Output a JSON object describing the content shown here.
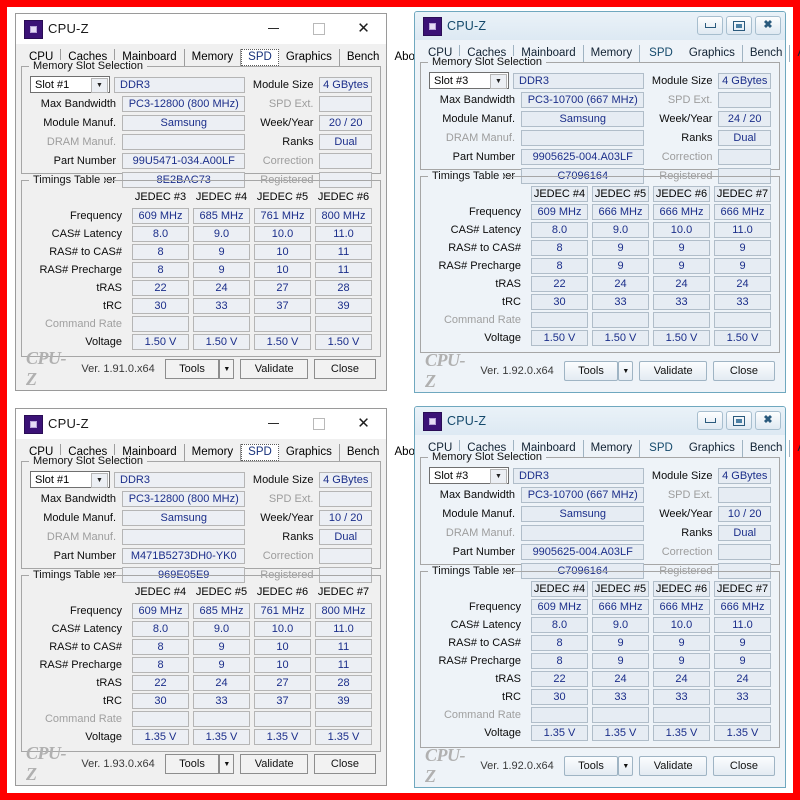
{
  "theme": {
    "outer_border_color": "#ff0000",
    "field_text_color": "#1b2e8a",
    "disabled_label_color": "#9d9d9d"
  },
  "common": {
    "window_title": "CPU-Z",
    "tabs": [
      "CPU",
      "Caches",
      "Mainboard",
      "Memory",
      "SPD",
      "Graphics",
      "Bench",
      "About"
    ],
    "selected_tab": "SPD",
    "group_slot_legend": "Memory Slot Selection",
    "group_timings_legend": "Timings Table",
    "labels": {
      "max_bandwidth": "Max Bandwidth",
      "module_manuf": "Module Manuf.",
      "dram_manuf": "DRAM Manuf.",
      "part_number": "Part Number",
      "serial_number": "Serial Number",
      "module_size": "Module Size",
      "spd_ext": "SPD Ext.",
      "week_year": "Week/Year",
      "ranks": "Ranks",
      "correction": "Correction",
      "registered": "Registered"
    },
    "timing_rows": [
      "Frequency",
      "CAS# Latency",
      "RAS# to CAS#",
      "RAS# Precharge",
      "tRAS",
      "tRC",
      "Command Rate",
      "Voltage"
    ],
    "buttons": {
      "tools": "Tools",
      "dropdown": "▼",
      "validate": "Validate",
      "close": "Close"
    },
    "brand": "CPU-Z",
    "icons": {
      "app": "cpu-chip-icon",
      "minimize": "minimize-icon",
      "maximize": "maximize-icon",
      "close": "close-icon",
      "dropdown": "chevron-down-icon"
    }
  },
  "panels": [
    {
      "id": "top-left",
      "style": "w10",
      "version": "Ver. 1.91.0.x64",
      "slot": {
        "selected_slot": "Slot #1",
        "memory_type": "DDR3",
        "max_bandwidth": "PC3-12800 (800 MHz)",
        "module_manuf": "Samsung",
        "dram_manuf": "",
        "part_number": "99U5471-034.A00LF",
        "serial_number": "8E2BAC73",
        "module_size": "4 GBytes",
        "spd_ext": "",
        "week_year": "20 / 20",
        "ranks": "Dual",
        "correction": "",
        "registered": ""
      },
      "timings": {
        "columns": [
          "JEDEC #3",
          "JEDEC #4",
          "JEDEC #5",
          "JEDEC #6"
        ],
        "rows": [
          {
            "label": "Frequency",
            "values": [
              "609 MHz",
              "685 MHz",
              "761 MHz",
              "800 MHz"
            ],
            "disabled": false
          },
          {
            "label": "CAS# Latency",
            "values": [
              "8.0",
              "9.0",
              "10.0",
              "11.0"
            ],
            "disabled": false
          },
          {
            "label": "RAS# to CAS#",
            "values": [
              "8",
              "9",
              "10",
              "11"
            ],
            "disabled": false
          },
          {
            "label": "RAS# Precharge",
            "values": [
              "8",
              "9",
              "10",
              "11"
            ],
            "disabled": false
          },
          {
            "label": "tRAS",
            "values": [
              "22",
              "24",
              "27",
              "28"
            ],
            "disabled": false
          },
          {
            "label": "tRC",
            "values": [
              "30",
              "33",
              "37",
              "39"
            ],
            "disabled": false
          },
          {
            "label": "Command Rate",
            "values": [
              "",
              "",
              "",
              ""
            ],
            "disabled": true
          },
          {
            "label": "Voltage",
            "values": [
              "1.50 V",
              "1.50 V",
              "1.50 V",
              "1.50 V"
            ],
            "disabled": false
          }
        ]
      }
    },
    {
      "id": "top-right",
      "style": "aero",
      "version": "Ver. 1.92.0.x64",
      "slot": {
        "selected_slot": "Slot #3",
        "memory_type": "DDR3",
        "max_bandwidth": "PC3-10700 (667 MHz)",
        "module_manuf": "Samsung",
        "dram_manuf": "",
        "part_number": "9905625-004.A03LF",
        "serial_number": "C7096164",
        "module_size": "4 GBytes",
        "spd_ext": "",
        "week_year": "24 / 20",
        "ranks": "Dual",
        "correction": "",
        "registered": ""
      },
      "timings": {
        "columns": [
          "JEDEC #4",
          "JEDEC #5",
          "JEDEC #6",
          "JEDEC #7"
        ],
        "rows": [
          {
            "label": "Frequency",
            "values": [
              "609 MHz",
              "666 MHz",
              "666 MHz",
              "666 MHz"
            ],
            "disabled": false
          },
          {
            "label": "CAS# Latency",
            "values": [
              "8.0",
              "9.0",
              "10.0",
              "11.0"
            ],
            "disabled": false
          },
          {
            "label": "RAS# to CAS#",
            "values": [
              "8",
              "9",
              "9",
              "9"
            ],
            "disabled": false
          },
          {
            "label": "RAS# Precharge",
            "values": [
              "8",
              "9",
              "9",
              "9"
            ],
            "disabled": false
          },
          {
            "label": "tRAS",
            "values": [
              "22",
              "24",
              "24",
              "24"
            ],
            "disabled": false
          },
          {
            "label": "tRC",
            "values": [
              "30",
              "33",
              "33",
              "33"
            ],
            "disabled": false
          },
          {
            "label": "Command Rate",
            "values": [
              "",
              "",
              "",
              ""
            ],
            "disabled": true
          },
          {
            "label": "Voltage",
            "values": [
              "1.50 V",
              "1.50 V",
              "1.50 V",
              "1.50 V"
            ],
            "disabled": false
          }
        ]
      }
    },
    {
      "id": "bottom-left",
      "style": "w10",
      "version": "Ver. 1.93.0.x64",
      "slot": {
        "selected_slot": "Slot #1",
        "memory_type": "DDR3",
        "max_bandwidth": "PC3-12800 (800 MHz)",
        "module_manuf": "Samsung",
        "dram_manuf": "",
        "part_number": "M471B5273DH0-YK0",
        "serial_number": "969E05E9",
        "module_size": "4 GBytes",
        "spd_ext": "",
        "week_year": "10 / 20",
        "ranks": "Dual",
        "correction": "",
        "registered": ""
      },
      "timings": {
        "columns": [
          "JEDEC #4",
          "JEDEC #5",
          "JEDEC #6",
          "JEDEC #7"
        ],
        "rows": [
          {
            "label": "Frequency",
            "values": [
              "609 MHz",
              "685 MHz",
              "761 MHz",
              "800 MHz"
            ],
            "disabled": false
          },
          {
            "label": "CAS# Latency",
            "values": [
              "8.0",
              "9.0",
              "10.0",
              "11.0"
            ],
            "disabled": false
          },
          {
            "label": "RAS# to CAS#",
            "values": [
              "8",
              "9",
              "10",
              "11"
            ],
            "disabled": false
          },
          {
            "label": "RAS# Precharge",
            "values": [
              "8",
              "9",
              "10",
              "11"
            ],
            "disabled": false
          },
          {
            "label": "tRAS",
            "values": [
              "22",
              "24",
              "27",
              "28"
            ],
            "disabled": false
          },
          {
            "label": "tRC",
            "values": [
              "30",
              "33",
              "37",
              "39"
            ],
            "disabled": false
          },
          {
            "label": "Command Rate",
            "values": [
              "",
              "",
              "",
              ""
            ],
            "disabled": true
          },
          {
            "label": "Voltage",
            "values": [
              "1.35 V",
              "1.35 V",
              "1.35 V",
              "1.35 V"
            ],
            "disabled": false
          }
        ]
      }
    },
    {
      "id": "bottom-right",
      "style": "aero",
      "version": "Ver. 1.92.0.x64",
      "slot": {
        "selected_slot": "Slot #3",
        "memory_type": "DDR3",
        "max_bandwidth": "PC3-10700 (667 MHz)",
        "module_manuf": "Samsung",
        "dram_manuf": "",
        "part_number": "9905625-004.A03LF",
        "serial_number": "C7096164",
        "module_size": "4 GBytes",
        "spd_ext": "",
        "week_year": "10 / 20",
        "ranks": "Dual",
        "correction": "",
        "registered": ""
      },
      "timings": {
        "columns": [
          "JEDEC #4",
          "JEDEC #5",
          "JEDEC #6",
          "JEDEC #7"
        ],
        "rows": [
          {
            "label": "Frequency",
            "values": [
              "609 MHz",
              "666 MHz",
              "666 MHz",
              "666 MHz"
            ],
            "disabled": false
          },
          {
            "label": "CAS# Latency",
            "values": [
              "8.0",
              "9.0",
              "10.0",
              "11.0"
            ],
            "disabled": false
          },
          {
            "label": "RAS# to CAS#",
            "values": [
              "8",
              "9",
              "9",
              "9"
            ],
            "disabled": false
          },
          {
            "label": "RAS# Precharge",
            "values": [
              "8",
              "9",
              "9",
              "9"
            ],
            "disabled": false
          },
          {
            "label": "tRAS",
            "values": [
              "22",
              "24",
              "24",
              "24"
            ],
            "disabled": false
          },
          {
            "label": "tRC",
            "values": [
              "30",
              "33",
              "33",
              "33"
            ],
            "disabled": false
          },
          {
            "label": "Command Rate",
            "values": [
              "",
              "",
              "",
              ""
            ],
            "disabled": true
          },
          {
            "label": "Voltage",
            "values": [
              "1.35 V",
              "1.35 V",
              "1.35 V",
              "1.35 V"
            ],
            "disabled": false
          }
        ]
      }
    }
  ]
}
